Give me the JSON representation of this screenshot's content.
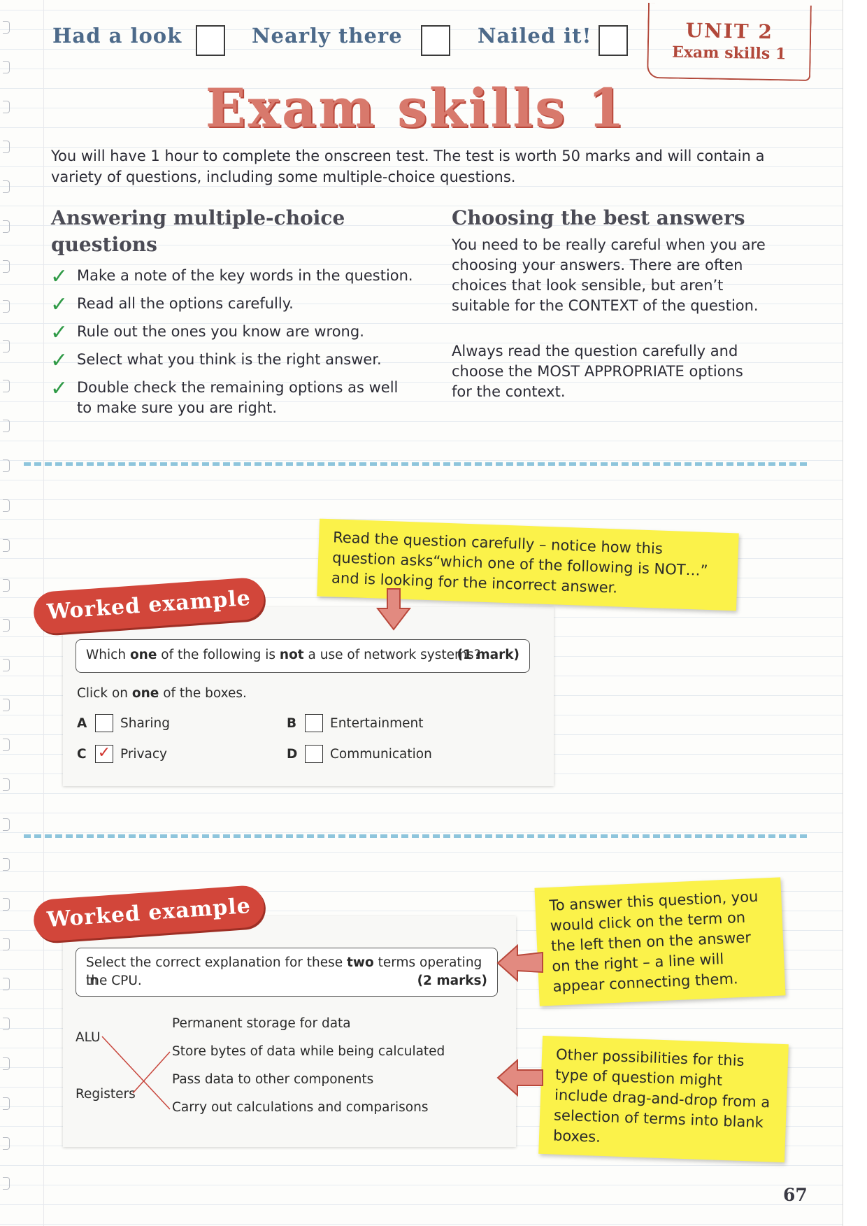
{
  "header": {
    "confidence_1": "Had a look",
    "confidence_2": "Nearly there",
    "confidence_3": "Nailed it!",
    "unit": "UNIT 2",
    "unit_section": "Exam skills 1"
  },
  "title": "Exam skills 1",
  "intro": "You will have 1 hour to complete the onscreen test. The test is worth 50 marks and will contain a variety of questions, including some multiple-choice questions.",
  "left_section": {
    "heading_line1": "Answering multiple-choice",
    "heading_line2": "questions",
    "tick_icon": "tick-icon",
    "items": [
      "Make a note of the key words in the question.",
      "Read all the options carefully.",
      "Rule out the ones you know are wrong.",
      "Select what you think is the right answer.",
      "Double check the remaining options as well to make sure you are right."
    ]
  },
  "right_section": {
    "heading": "Choosing the best answers",
    "para1": "You need to be really careful when you are choosing your answers. There are often choices that look sensible, but aren’t suitable for the CONTEXT of the question.",
    "para2": "Always read the question carefully and choose the MOST APPROPRIATE options for the context."
  },
  "example1": {
    "badge": "Worked example",
    "note": "Read the question carefully – notice how this question asks“which one of the following is NOT…” and is looking for the incorrect answer.",
    "question_pre": "Which ",
    "question_one": "one",
    "question_mid": " of the following is ",
    "question_not": "not",
    "question_post": " a use of network systems?",
    "marks": "(1 mark)",
    "instruction_pre": "Click on ",
    "instruction_one": "one",
    "instruction_post": " of the boxes.",
    "options": [
      {
        "letter": "A",
        "text": "Sharing",
        "checked": false
      },
      {
        "letter": "B",
        "text": "Entertainment",
        "checked": false
      },
      {
        "letter": "C",
        "text": "Privacy",
        "checked": true
      },
      {
        "letter": "D",
        "text": "Communication",
        "checked": false
      }
    ],
    "check_mark": "✓",
    "accent_color": "#d2463a",
    "note_color": "#fbf24a"
  },
  "example2": {
    "badge": "Worked example",
    "question_pre": "Select the correct explanation for these ",
    "question_bold": "two",
    "question_post": " terms operating in",
    "question_line2": "the CPU.",
    "marks": "(2 marks)",
    "terms": [
      "ALU",
      "Registers"
    ],
    "answers": [
      "Permanent storage for data",
      "Store bytes of data while being calculated",
      "Pass data to other components",
      "Carry out calculations and comparisons"
    ],
    "note1": "To answer this question, you would click on the term on the left then on the answer on the right – a line will appear connecting them.",
    "note2": "Other possibilities for this type of question might include drag-and-drop from a selection of terms into blank boxes.",
    "line_color": "#c8463c"
  },
  "page_number": "67"
}
